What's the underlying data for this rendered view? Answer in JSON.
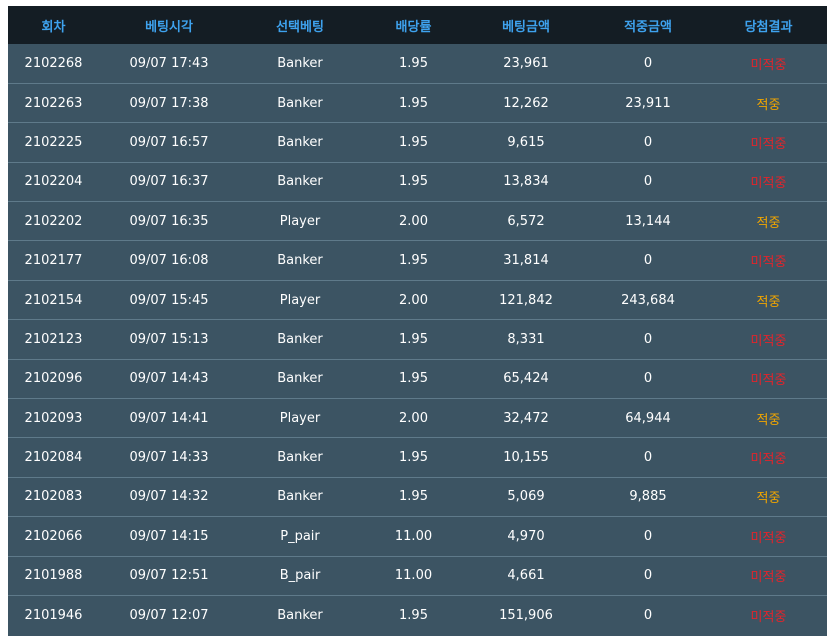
{
  "table": {
    "headers": [
      "회차",
      "베팅시각",
      "선택베팅",
      "배당률",
      "베팅금액",
      "적중금액",
      "당첨결과"
    ],
    "rows": [
      {
        "round": "2102268",
        "time": "09/07 17:43",
        "pick": "Banker",
        "odds": "1.95",
        "bet": "23,961",
        "win": "0",
        "result": "미적중",
        "status": "lose"
      },
      {
        "round": "2102263",
        "time": "09/07 17:38",
        "pick": "Banker",
        "odds": "1.95",
        "bet": "12,262",
        "win": "23,911",
        "result": "적중",
        "status": "win"
      },
      {
        "round": "2102225",
        "time": "09/07 16:57",
        "pick": "Banker",
        "odds": "1.95",
        "bet": "9,615",
        "win": "0",
        "result": "미적중",
        "status": "lose"
      },
      {
        "round": "2102204",
        "time": "09/07 16:37",
        "pick": "Banker",
        "odds": "1.95",
        "bet": "13,834",
        "win": "0",
        "result": "미적중",
        "status": "lose"
      },
      {
        "round": "2102202",
        "time": "09/07 16:35",
        "pick": "Player",
        "odds": "2.00",
        "bet": "6,572",
        "win": "13,144",
        "result": "적중",
        "status": "win"
      },
      {
        "round": "2102177",
        "time": "09/07 16:08",
        "pick": "Banker",
        "odds": "1.95",
        "bet": "31,814",
        "win": "0",
        "result": "미적중",
        "status": "lose"
      },
      {
        "round": "2102154",
        "time": "09/07 15:45",
        "pick": "Player",
        "odds": "2.00",
        "bet": "121,842",
        "win": "243,684",
        "result": "적중",
        "status": "win"
      },
      {
        "round": "2102123",
        "time": "09/07 15:13",
        "pick": "Banker",
        "odds": "1.95",
        "bet": "8,331",
        "win": "0",
        "result": "미적중",
        "status": "lose"
      },
      {
        "round": "2102096",
        "time": "09/07 14:43",
        "pick": "Banker",
        "odds": "1.95",
        "bet": "65,424",
        "win": "0",
        "result": "미적중",
        "status": "lose"
      },
      {
        "round": "2102093",
        "time": "09/07 14:41",
        "pick": "Player",
        "odds": "2.00",
        "bet": "32,472",
        "win": "64,944",
        "result": "적중",
        "status": "win"
      },
      {
        "round": "2102084",
        "time": "09/07 14:33",
        "pick": "Banker",
        "odds": "1.95",
        "bet": "10,155",
        "win": "0",
        "result": "미적중",
        "status": "lose"
      },
      {
        "round": "2102083",
        "time": "09/07 14:32",
        "pick": "Banker",
        "odds": "1.95",
        "bet": "5,069",
        "win": "9,885",
        "result": "적중",
        "status": "win"
      },
      {
        "round": "2102066",
        "time": "09/07 14:15",
        "pick": "P_pair",
        "odds": "11.00",
        "bet": "4,970",
        "win": "0",
        "result": "미적중",
        "status": "lose"
      },
      {
        "round": "2101988",
        "time": "09/07 12:51",
        "pick": "B_pair",
        "odds": "11.00",
        "bet": "4,661",
        "win": "0",
        "result": "미적중",
        "status": "lose"
      },
      {
        "round": "2101946",
        "time": "09/07 12:07",
        "pick": "Banker",
        "odds": "1.95",
        "bet": "151,906",
        "win": "0",
        "result": "미적중",
        "status": "lose"
      }
    ]
  },
  "colors": {
    "header_bg": "#141d24",
    "header_text": "#3ea2ee",
    "row_bg": "#3c5463",
    "row_divider": "#5f7a8a",
    "win": "#f0a500",
    "lose": "#e3242b"
  }
}
